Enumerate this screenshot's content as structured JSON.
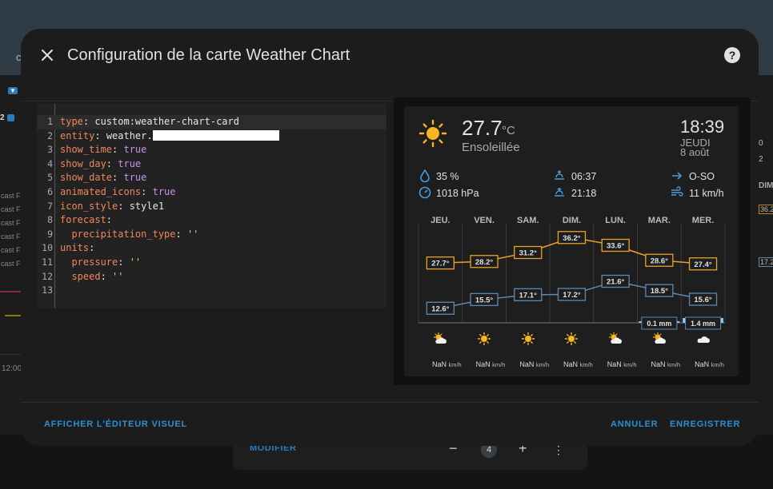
{
  "background": {
    "header_text": "c",
    "left_labels": [
      "cast F",
      "cast F",
      "cast F",
      "cast F",
      "cast F",
      "cast F"
    ],
    "left_badge1": "▼",
    "left_badge2": "2",
    "time": "12:00",
    "right_items": [
      "0",
      "2",
      "DIM",
      "36.2",
      "17.2"
    ],
    "bottom": {
      "modify": "MODIFIER",
      "count": "4",
      "minus": "−",
      "plus": "+",
      "more": "⋮"
    }
  },
  "dialog": {
    "title": "Configuration de la carte Weather Chart",
    "close_icon": "close-icon",
    "help_icon": "help-icon",
    "footer": {
      "visual_editor": "AFFICHER L'ÉDITEUR VISUEL",
      "cancel": "ANNULER",
      "save": "ENREGISTRER"
    }
  },
  "editor": {
    "lines": [
      {
        "n": "1",
        "key": "type",
        "sep": ": ",
        "val": "custom:weather-chart-card",
        "vtype": "v"
      },
      {
        "n": "2",
        "key": "entity",
        "sep": ": ",
        "val": "weather.",
        "vtype": "v",
        "redacted": true
      },
      {
        "n": "3",
        "key": "show_time",
        "sep": ": ",
        "val": "true",
        "vtype": "b"
      },
      {
        "n": "4",
        "key": "show_day",
        "sep": ": ",
        "val": "true",
        "vtype": "b"
      },
      {
        "n": "5",
        "key": "show_date",
        "sep": ": ",
        "val": "true",
        "vtype": "b"
      },
      {
        "n": "6",
        "key": "animated_icons",
        "sep": ": ",
        "val": "true",
        "vtype": "b"
      },
      {
        "n": "7",
        "key": "icon_style",
        "sep": ": ",
        "val": "style1",
        "vtype": "v"
      },
      {
        "n": "8",
        "key": "forecast",
        "sep": ":",
        "val": "",
        "vtype": "v"
      },
      {
        "n": "9",
        "key": "  precipitation_type",
        "sep": ": ",
        "val": "''",
        "vtype": "s"
      },
      {
        "n": "10",
        "key": "units",
        "sep": ":",
        "val": "",
        "vtype": "v"
      },
      {
        "n": "11",
        "key": "  pressure",
        "sep": ": ",
        "val": "''",
        "vtype": "s"
      },
      {
        "n": "12",
        "key": "  speed",
        "sep": ": ",
        "val": "''",
        "vtype": "s"
      },
      {
        "n": "13",
        "key": "",
        "sep": "",
        "val": "",
        "vtype": "v"
      }
    ]
  },
  "weather": {
    "temperature": "27.7",
    "unit": "°C",
    "condition": "Ensoleillée",
    "time": "18:39",
    "day": "JEUDI",
    "date": "8 août",
    "humidity": "35 %",
    "pressure": "1018 hPa",
    "sunrise": "06:37",
    "sunset": "21:18",
    "wind_dir": "O-SO",
    "wind_speed": "11 km/h",
    "colors": {
      "high": "#e8a228",
      "low": "#5d88b3",
      "precip": "#8fcdf5",
      "sun": "#f7b51f"
    }
  },
  "chart_data": {
    "type": "line",
    "categories": [
      "JEU.",
      "VEN.",
      "SAM.",
      "DIM.",
      "LUN.",
      "MAR.",
      "MER."
    ],
    "series": [],
    "high_values": [
      27.7,
      28.2,
      31.2,
      36.2,
      33.6,
      28.6,
      27.4
    ],
    "low_values": [
      12.6,
      15.5,
      17.1,
      17.2,
      21.6,
      18.5,
      15.6
    ],
    "high_labels": [
      "27.7°",
      "28.2°",
      "31.2°",
      "36.2°",
      "33.6°",
      "28.6°",
      "27.4°"
    ],
    "low_labels": [
      "12.6°",
      "15.5°",
      "17.1°",
      "17.2°",
      "21.6°",
      "18.5°",
      "15.6°"
    ],
    "precipitation": [
      0,
      0,
      0,
      0,
      0,
      0.1,
      1.4
    ],
    "precip_labels": [
      "",
      "",
      "",
      "",
      "",
      "0.1 mm",
      "1.4 mm"
    ],
    "icons": [
      "partly-cloudy-icon",
      "sunny-icon",
      "sunny-icon",
      "sunny-icon",
      "partly-cloudy-icon",
      "partly-cloudy-icon",
      "cloudy-icon"
    ],
    "wind": [
      "NaN",
      "NaN",
      "NaN",
      "NaN",
      "NaN",
      "NaN",
      "NaN"
    ],
    "wind_unit": "km/h",
    "ylim": [
      8,
      40
    ]
  }
}
